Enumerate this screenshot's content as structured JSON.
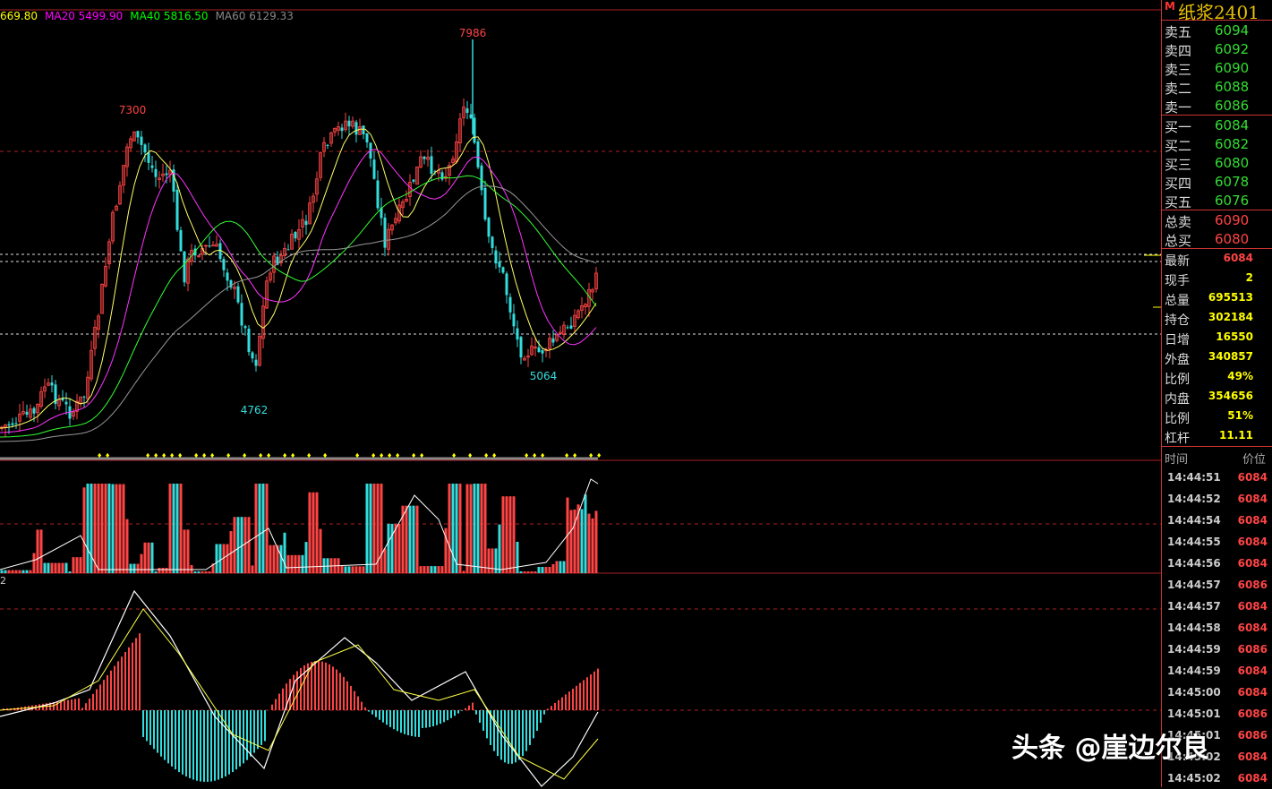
{
  "symbol": "纸浆2401",
  "badge": "M",
  "ma_legend": [
    {
      "text": "669.80",
      "color": "#ffff00"
    },
    {
      "text": "MA20 5499.90",
      "color": "#ff00ff"
    },
    {
      "text": "MA40 5816.50",
      "color": "#00ff00"
    },
    {
      "text": "MA60 6129.33",
      "color": "#888888"
    }
  ],
  "annotations": {
    "high1": "7300",
    "high2": "7986",
    "low1": "4762",
    "low2": "5064"
  },
  "macd_label": "2",
  "order_book": {
    "asks": [
      {
        "label": "卖五",
        "price": "6094"
      },
      {
        "label": "卖四",
        "price": "6092"
      },
      {
        "label": "卖三",
        "price": "6090"
      },
      {
        "label": "卖二",
        "price": "6088"
      },
      {
        "label": "卖一",
        "price": "6086"
      }
    ],
    "bids": [
      {
        "label": "买一",
        "price": "6084"
      },
      {
        "label": "买二",
        "price": "6082"
      },
      {
        "label": "买三",
        "price": "6080"
      },
      {
        "label": "买四",
        "price": "6078"
      },
      {
        "label": "买五",
        "price": "6076"
      }
    ],
    "totals": [
      {
        "label": "总卖",
        "value": "6090"
      },
      {
        "label": "总买",
        "value": "6080"
      }
    ]
  },
  "stats": [
    {
      "label": "最新",
      "value": "6084",
      "color": "#ff4444"
    },
    {
      "label": "现手",
      "value": "2",
      "color": "#ffff00"
    },
    {
      "label": "总量",
      "value": "695513",
      "color": "#ffff00"
    },
    {
      "label": "持仓",
      "value": "302184",
      "color": "#ffff00"
    },
    {
      "label": "日增",
      "value": "16550",
      "color": "#ffff00"
    },
    {
      "label": "外盘",
      "value": "340857",
      "color": "#ffff00"
    },
    {
      "label": "比例",
      "value": "49%",
      "color": "#ffff00"
    },
    {
      "label": "内盘",
      "value": "354656",
      "color": "#ffff00"
    },
    {
      "label": "比例",
      "value": "51%",
      "color": "#ffff00"
    },
    {
      "label": "杠杆",
      "value": "11.11",
      "color": "#ffff00"
    }
  ],
  "ticks_header": {
    "time": "时间",
    "price": "价位"
  },
  "ticks": [
    {
      "time": "14:44:51",
      "price": "6084"
    },
    {
      "time": "14:44:52",
      "price": "6084"
    },
    {
      "time": "14:44:54",
      "price": "6084"
    },
    {
      "time": "14:44:55",
      "price": "6084"
    },
    {
      "time": "14:44:56",
      "price": "6084"
    },
    {
      "time": "14:44:57",
      "price": "6086"
    },
    {
      "time": "14:44:57",
      "price": "6084"
    },
    {
      "time": "14:44:58",
      "price": "6084"
    },
    {
      "time": "14:44:59",
      "price": "6086"
    },
    {
      "time": "14:44:59",
      "price": "6084"
    },
    {
      "time": "14:45:00",
      "price": "6084"
    },
    {
      "time": "14:45:01",
      "price": "6086"
    },
    {
      "time": "14:45:01",
      "price": "6086"
    },
    {
      "time": "14:45:02",
      "price": "6084"
    },
    {
      "time": "14:45:02",
      "price": "6084"
    }
  ],
  "watermark": "头条 @崖边尔良",
  "colors": {
    "up": "#ff4444",
    "down": "#33dddd",
    "grid": "#aa2222",
    "ask_price": "#33dd33"
  }
}
